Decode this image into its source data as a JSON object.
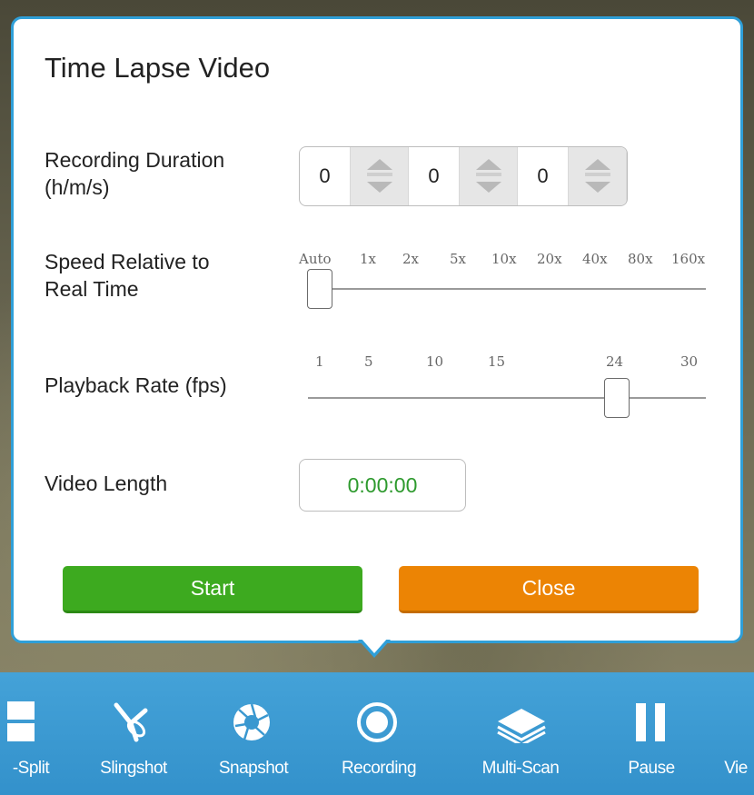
{
  "dialog": {
    "title": "Time Lapse Video",
    "duration": {
      "label_line1": "Recording Duration",
      "label_line2": "(h/m/s)",
      "hours": "0",
      "minutes": "0",
      "seconds": "0"
    },
    "speed": {
      "label_line1": "Speed Relative to",
      "label_line2": "Real Time",
      "ticks": [
        "Auto",
        "1x",
        "2x",
        "5x",
        "10x",
        "20x",
        "40x",
        "80x",
        "160x"
      ],
      "selected": "Auto"
    },
    "playback": {
      "label": "Playback Rate (fps)",
      "ticks": [
        "1",
        "5",
        "10",
        "15",
        "24",
        "30"
      ],
      "value": 24
    },
    "video_length": {
      "label": "Video Length",
      "value": "0:00:00"
    },
    "start_label": "Start",
    "close_label": "Close"
  },
  "toolbar": {
    "items": [
      {
        "label": "-Split",
        "icon": "split-icon"
      },
      {
        "label": "Slingshot",
        "icon": "slingshot-icon"
      },
      {
        "label": "Snapshot",
        "icon": "aperture-icon"
      },
      {
        "label": "Recording",
        "icon": "record-icon"
      },
      {
        "label": "Multi-Scan",
        "icon": "layers-icon"
      },
      {
        "label": "Pause",
        "icon": "pause-icon"
      },
      {
        "label": "Vie",
        "icon": "view-icon"
      }
    ]
  },
  "colors": {
    "accent": "#2f9fd8",
    "start": "#3daa1f",
    "close": "#ec8404",
    "length_text": "#2e9a2e",
    "toolbar": "#3a98d0"
  }
}
